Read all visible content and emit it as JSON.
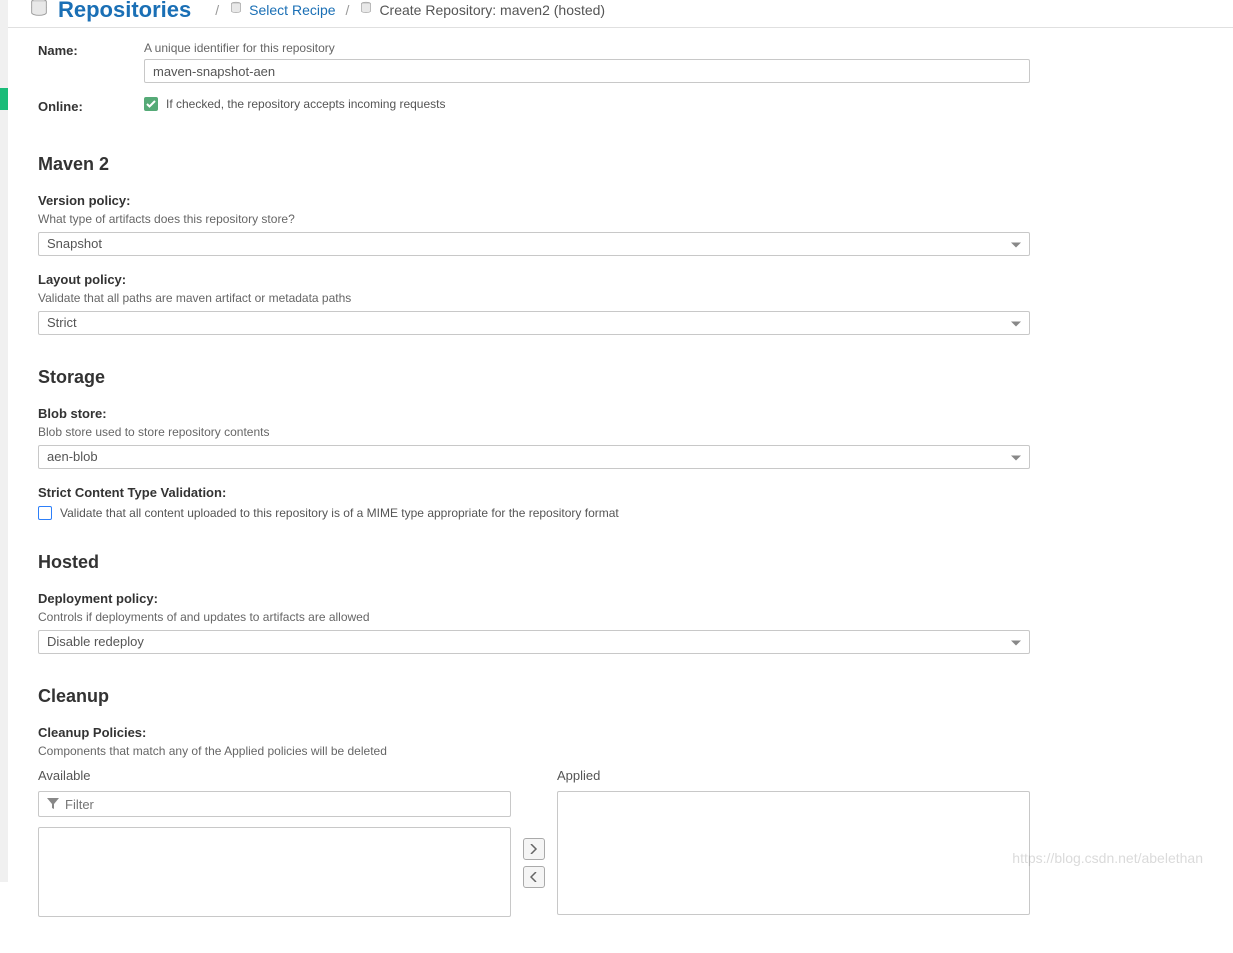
{
  "header": {
    "title": "Repositories",
    "breadcrumb_select": "Select Recipe",
    "breadcrumb_current": "Create Repository: maven2 (hosted)"
  },
  "form": {
    "name": {
      "label": "Name:",
      "help": "A unique identifier for this repository",
      "value": "maven-snapshot-aen"
    },
    "online": {
      "label": "Online:",
      "text": "If checked, the repository accepts incoming requests",
      "checked": true
    }
  },
  "maven2": {
    "title": "Maven 2",
    "version_policy": {
      "label": "Version policy:",
      "help": "What type of artifacts does this repository store?",
      "value": "Snapshot"
    },
    "layout_policy": {
      "label": "Layout policy:",
      "help": "Validate that all paths are maven artifact or metadata paths",
      "value": "Strict"
    }
  },
  "storage": {
    "title": "Storage",
    "blob_store": {
      "label": "Blob store:",
      "help": "Blob store used to store repository contents",
      "value": "aen-blob"
    },
    "strict_content": {
      "label": "Strict Content Type Validation:",
      "text": "Validate that all content uploaded to this repository is of a MIME type appropriate for the repository format",
      "checked": false
    }
  },
  "hosted": {
    "title": "Hosted",
    "deployment_policy": {
      "label": "Deployment policy:",
      "help": "Controls if deployments of and updates to artifacts are allowed",
      "value": "Disable redeploy"
    }
  },
  "cleanup": {
    "title": "Cleanup",
    "policies_label": "Cleanup Policies:",
    "policies_help": "Components that match any of the Applied policies will be deleted",
    "available_title": "Available",
    "applied_title": "Applied",
    "filter_placeholder": "Filter"
  },
  "watermark": "https://blog.csdn.net/abelethan"
}
